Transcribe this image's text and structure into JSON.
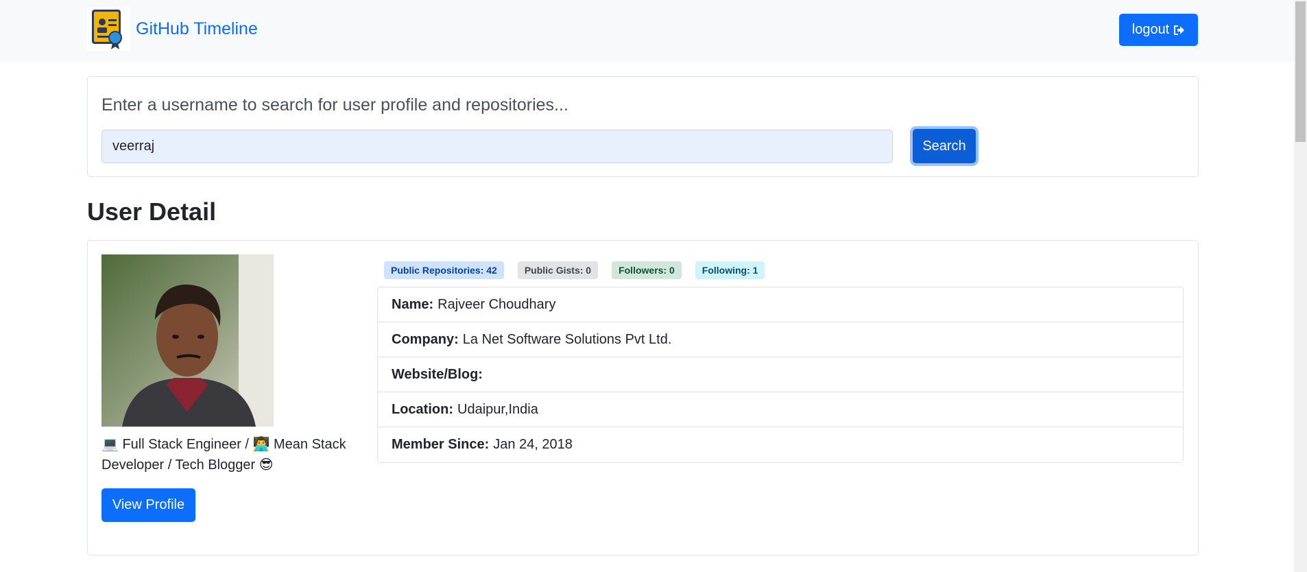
{
  "navbar": {
    "brand": "GitHub Timeline",
    "logout_label": "logout"
  },
  "search": {
    "lead": "Enter a username to search for user profile and repositories...",
    "value": "veerraj",
    "button_label": "Search"
  },
  "section_title": "User Detail",
  "user": {
    "bio": "💻 Full Stack Engineer / 👨‍💻 Mean Stack Developer / Tech Blogger 😎",
    "view_profile_label": "View Profile",
    "badges": {
      "repos": "Public Repositories: 42",
      "gists": "Public Gists: 0",
      "followers": "Followers: 0",
      "following": "Following: 1"
    },
    "details": {
      "name_label": "Name:",
      "name_value": "Rajveer Choudhary",
      "company_label": "Company:",
      "company_value": "La Net Software Solutions Pvt Ltd.",
      "website_label": "Website/Blog:",
      "website_value": "",
      "location_label": "Location:",
      "location_value": "Udaipur,India",
      "member_label": "Member Since:",
      "member_value": "Jan 24, 2018"
    }
  },
  "colors": {
    "primary": "#0d6efd",
    "navbar_bg": "#f8f9fa"
  },
  "icons": [
    "certificate-logo-icon",
    "sign-out-icon"
  ]
}
